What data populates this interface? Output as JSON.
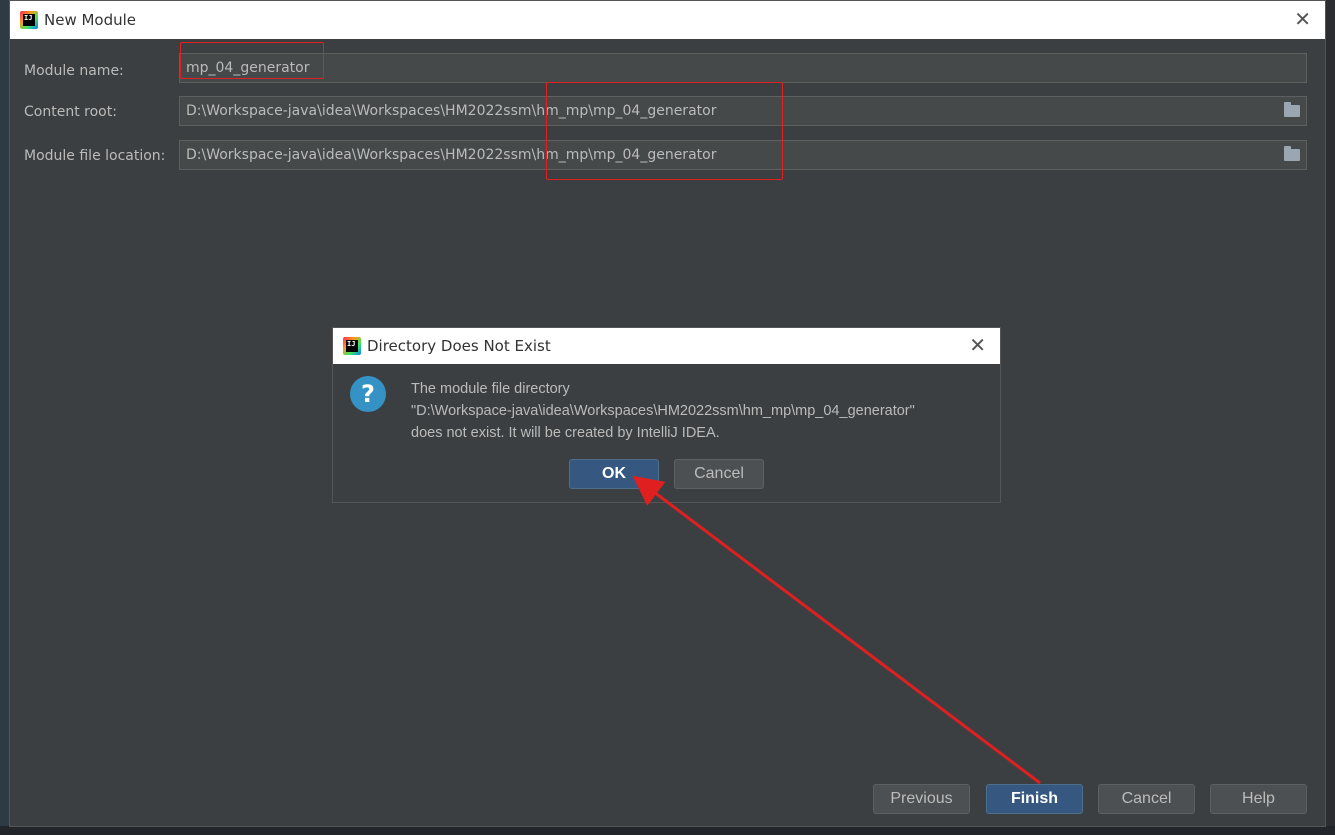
{
  "main_window": {
    "title": "New Module",
    "close_icon": "close-icon",
    "fields": {
      "module_name": {
        "label": "Module name:",
        "value": "mp_04_generator"
      },
      "content_root": {
        "label": "Content root:",
        "value": "D:\\Workspace-java\\idea\\Workspaces\\HM2022ssm\\hm_mp\\mp_04_generator"
      },
      "module_file_location": {
        "label": "Module file location:",
        "value": "D:\\Workspace-java\\idea\\Workspaces\\HM2022ssm\\hm_mp\\mp_04_generator"
      }
    },
    "buttons": {
      "previous": "Previous",
      "finish": "Finish",
      "cancel": "Cancel",
      "help": "Help"
    }
  },
  "dialog": {
    "title": "Directory Does Not Exist",
    "message_line1": "The module file directory",
    "message_line2": "\"D:\\Workspace-java\\idea\\Workspaces\\HM2022ssm\\hm_mp\\mp_04_generator\"",
    "message_line3": "does not exist. It will be created by IntelliJ IDEA.",
    "ok": "OK",
    "cancel": "Cancel",
    "icon": "question-icon"
  },
  "app_icon_text": "IJ",
  "colors": {
    "window_bg": "#3c3f41",
    "input_bg": "#45494a",
    "primary_button": "#365880",
    "annotation_red": "#e02020",
    "question_icon": "#3592c4"
  }
}
